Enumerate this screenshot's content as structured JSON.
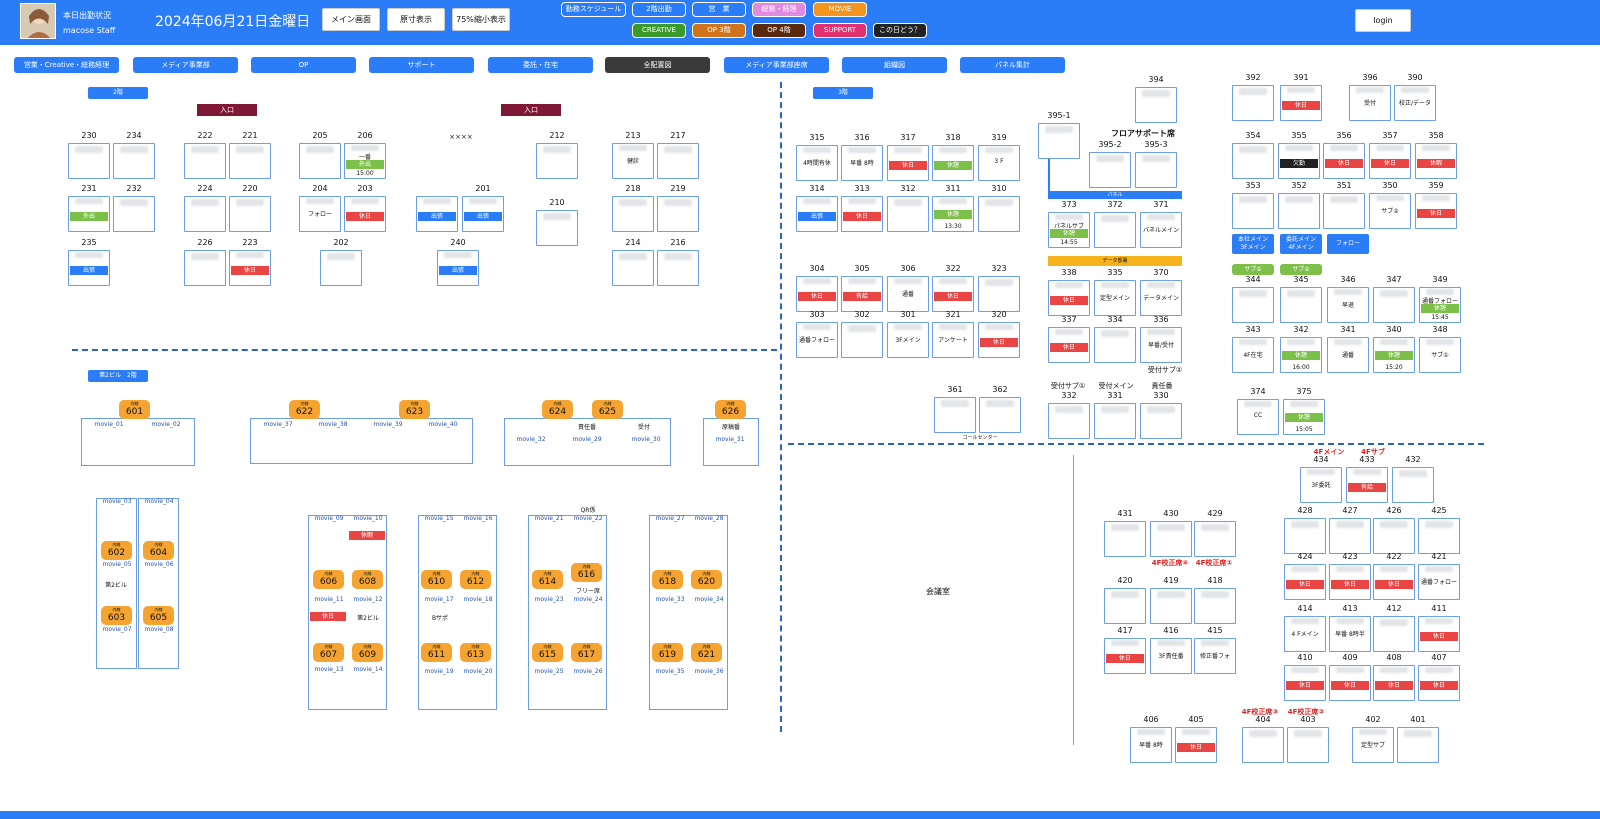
{
  "header": {
    "status_title": "本日出勤状況",
    "user": "macose Staff",
    "date": "2024年06月21日金曜日",
    "buttons": {
      "main": "メイン画面",
      "original": "原寸表示",
      "reduced": "75%縮小表示",
      "login": "login"
    },
    "pills_row1": [
      "勤務スケジュール",
      "2階出勤",
      "営　業",
      "総務・経理",
      "MOVIE"
    ],
    "pills_row2": [
      "CREATIVE",
      "OP 3階",
      "OP 4階",
      "SUPPORT",
      "この日どう？"
    ]
  },
  "tabs": [
    "営業・Creative・総務経理",
    "メディア事業部",
    "OP",
    "サポート",
    "委託・在宅",
    "全配置図",
    "メディア事業部座席",
    "組織図",
    "パネル集計"
  ],
  "labels": {
    "floor2": "2階",
    "floor3": "3階",
    "bldg2": "第2ビル　2階",
    "entrance": "入口",
    "xxxx": "××××",
    "floor_support": "フロアサポート席",
    "panel": "パネル",
    "data_support": "データ部署",
    "call_center": "コールセンター",
    "meeting_room": "会議室",
    "qr": "QR係",
    "seki": "責任番",
    "reception": "受付",
    "genko": "原稿番",
    "free": "フリー席",
    "reception_sub2": "受付サブ②",
    "reception_sub1": "受付サブ①",
    "reception_main": "受付メイン",
    "sekinin": "責任番",
    "main3f": "本社メイン\n3Fメイン",
    "main4f": "委託メイン\n4Fメイン",
    "follow": "フォロー",
    "sub1": "サブ①",
    "sub2": "サブ②",
    "r4f_main": "4Fメイン",
    "r4f_sub": "4Fサブ",
    "r4f_kosei4": "4F校正席④",
    "r4f_kosei1": "4F校正席①",
    "r4f_kosei3": "4F校正席③",
    "r4f_kosei2": "4F校正席②"
  },
  "seats_f2": [
    {
      "n": "230"
    },
    {
      "n": "234"
    },
    {
      "n": "231",
      "st": "外出",
      "c": "grn"
    },
    {
      "n": "232"
    },
    {
      "n": "235",
      "st": "出張",
      "c": "blu"
    },
    {
      "n": "222"
    },
    {
      "n": "221"
    },
    {
      "n": "224"
    },
    {
      "n": "220"
    },
    {
      "n": "226"
    },
    {
      "n": "223",
      "st": "休日",
      "c": "red"
    },
    {
      "n": "205"
    },
    {
      "n": "206",
      "txt": "一番",
      "st": "外出",
      "c": "grn",
      "tm": "15:00"
    },
    {
      "n": "204",
      "txt": "フォロー"
    },
    {
      "n": "203",
      "st": "休日",
      "c": "red"
    },
    {
      "n": "202"
    },
    {
      "n": "201a",
      "label": "",
      "st": "出張",
      "c": "blu"
    },
    {
      "n": "201",
      "st": "出張",
      "c": "blu"
    },
    {
      "n": "240",
      "st": "出張",
      "c": "blu"
    },
    {
      "n": "212"
    },
    {
      "n": "210"
    },
    {
      "n": "213",
      "txt": "健診"
    },
    {
      "n": "217"
    },
    {
      "n": "218"
    },
    {
      "n": "219"
    },
    {
      "n": "214"
    },
    {
      "n": "216"
    }
  ],
  "seats_f3": [
    {
      "n": "315",
      "txt": "4時間有休"
    },
    {
      "n": "316",
      "txt": "早番 8時"
    },
    {
      "n": "317",
      "st": "休日",
      "c": "red"
    },
    {
      "n": "318",
      "st": "休憩",
      "c": "grn"
    },
    {
      "n": "319",
      "txt": "3 F"
    },
    {
      "n": "314",
      "st": "出張",
      "c": "blu"
    },
    {
      "n": "313",
      "st": "休日",
      "c": "red"
    },
    {
      "n": "312"
    },
    {
      "n": "311",
      "st": "休憩",
      "c": "grn",
      "tm": "13:30"
    },
    {
      "n": "310"
    },
    {
      "n": "304",
      "st": "休日",
      "c": "red"
    },
    {
      "n": "305",
      "st": "有給",
      "c": "red"
    },
    {
      "n": "306",
      "txt": "通番"
    },
    {
      "n": "322",
      "st": "休日",
      "c": "red"
    },
    {
      "n": "323"
    },
    {
      "n": "303",
      "txt": "通番フォロー"
    },
    {
      "n": "302"
    },
    {
      "n": "301",
      "txt": "3Fメイン"
    },
    {
      "n": "321",
      "txt": "アンケート"
    },
    {
      "n": "320",
      "st": "休日",
      "c": "red"
    },
    {
      "n": "361"
    },
    {
      "n": "362"
    },
    {
      "n": "394"
    },
    {
      "n": "395-1"
    },
    {
      "n": "395-2"
    },
    {
      "n": "395-3"
    },
    {
      "n": "373",
      "txt": "パネルサブ",
      "st": "休憩",
      "c": "grn",
      "tm": "14:55"
    },
    {
      "n": "372"
    },
    {
      "n": "371",
      "txt": "パネルメイン"
    },
    {
      "n": "338",
      "st": "休日",
      "c": "red"
    },
    {
      "n": "335",
      "txt": "定型メイン"
    },
    {
      "n": "370",
      "txt": "データメイン"
    },
    {
      "n": "337",
      "st": "休日",
      "c": "red"
    },
    {
      "n": "334"
    },
    {
      "n": "336",
      "txt": "早番/受付"
    },
    {
      "n": "332"
    },
    {
      "n": "331"
    },
    {
      "n": "330"
    },
    {
      "n": "392"
    },
    {
      "n": "391",
      "st": "休日",
      "c": "red"
    },
    {
      "n": "396",
      "txt": "受付"
    },
    {
      "n": "390",
      "txt": "校正/データ"
    },
    {
      "n": "354"
    },
    {
      "n": "355",
      "st": "欠勤",
      "c": "blk"
    },
    {
      "n": "356",
      "st": "休日",
      "c": "red"
    },
    {
      "n": "357",
      "st": "休日",
      "c": "red"
    },
    {
      "n": "358",
      "st": "休暇",
      "c": "red"
    },
    {
      "n": "353"
    },
    {
      "n": "352"
    },
    {
      "n": "351"
    },
    {
      "n": "350",
      "txt": "サブ②"
    },
    {
      "n": "359",
      "st": "休日",
      "c": "red"
    },
    {
      "n": "344"
    },
    {
      "n": "345"
    },
    {
      "n": "346",
      "txt": "早退"
    },
    {
      "n": "347"
    },
    {
      "n": "349",
      "txt": "通番フォロー",
      "st": "休憩",
      "c": "grn",
      "tm": "15:45"
    },
    {
      "n": "343",
      "txt": "4F在宅"
    },
    {
      "n": "342",
      "st": "休憩",
      "c": "grn",
      "tm": "16:00"
    },
    {
      "n": "341",
      "txt": "通番"
    },
    {
      "n": "340",
      "st": "休憩",
      "c": "grn",
      "tm": "15:20"
    },
    {
      "n": "348",
      "txt": "サブ①"
    },
    {
      "n": "374",
      "txt": "CC"
    },
    {
      "n": "375",
      "st": "休憩",
      "c": "grn",
      "tm": "15:05"
    }
  ],
  "seats_f4": [
    {
      "n": "434",
      "txt": "3F委託"
    },
    {
      "n": "433",
      "st": "有給",
      "c": "red"
    },
    {
      "n": "432"
    },
    {
      "n": "428"
    },
    {
      "n": "427"
    },
    {
      "n": "426"
    },
    {
      "n": "425"
    },
    {
      "n": "424",
      "st": "休日",
      "c": "red"
    },
    {
      "n": "423",
      "st": "休日",
      "c": "red"
    },
    {
      "n": "422",
      "st": "休日",
      "c": "red"
    },
    {
      "n": "421",
      "txt": "通番フォロー"
    },
    {
      "n": "414",
      "txt": "4 Fメイン"
    },
    {
      "n": "413",
      "txt": "早番 8時半"
    },
    {
      "n": "412"
    },
    {
      "n": "411",
      "st": "休日",
      "c": "red"
    },
    {
      "n": "410",
      "st": "休日",
      "c": "red"
    },
    {
      "n": "409",
      "st": "休日",
      "c": "red"
    },
    {
      "n": "408",
      "st": "休日",
      "c": "red"
    },
    {
      "n": "407",
      "st": "休日",
      "c": "red"
    },
    {
      "n": "431"
    },
    {
      "n": "430"
    },
    {
      "n": "429"
    },
    {
      "n": "420"
    },
    {
      "n": "419"
    },
    {
      "n": "418"
    },
    {
      "n": "417",
      "st": "休日",
      "c": "red"
    },
    {
      "n": "416",
      "txt": "3F責任番"
    },
    {
      "n": "415",
      "txt": "修正番フォ"
    },
    {
      "n": "406",
      "txt": "早番 8時"
    },
    {
      "n": "405",
      "st": "休日",
      "c": "red"
    },
    {
      "n": "404"
    },
    {
      "n": "403"
    },
    {
      "n": "402",
      "txt": "定型サブ"
    },
    {
      "n": "401"
    }
  ],
  "bldg2": {
    "naisen": "内線",
    "exts": [
      "601",
      "622",
      "623",
      "624",
      "625",
      "626",
      "602",
      "604",
      "603",
      "605",
      "606",
      "608",
      "607",
      "609",
      "610",
      "612",
      "611",
      "613",
      "614",
      "616",
      "615",
      "617",
      "618",
      "620",
      "619",
      "621"
    ],
    "movies": [
      "movie_01",
      "movie_02",
      "movie_37",
      "movie_38",
      "movie_39",
      "movie_40",
      "movie_32",
      "movie_29",
      "movie_30",
      "movie_31",
      "movie_03",
      "movie_04",
      "movie_05",
      "movie_06",
      "movie_07",
      "movie_08",
      "movie_09",
      "movie_10",
      "movie_11",
      "movie_12",
      "movie_13",
      "movie_14",
      "movie_15",
      "movie_16",
      "movie_17",
      "movie_18",
      "movie_19",
      "movie_20",
      "movie_21",
      "movie_22",
      "movie_23",
      "movie_24",
      "movie_25",
      "movie_26",
      "movie_27",
      "movie_28",
      "movie_33",
      "movie_34",
      "movie_35",
      "movie_36"
    ],
    "notes": {
      "bldg2": "第2ビル",
      "bsupport": "Bサポ",
      "rest": "休日",
      "off": "休暇"
    }
  }
}
